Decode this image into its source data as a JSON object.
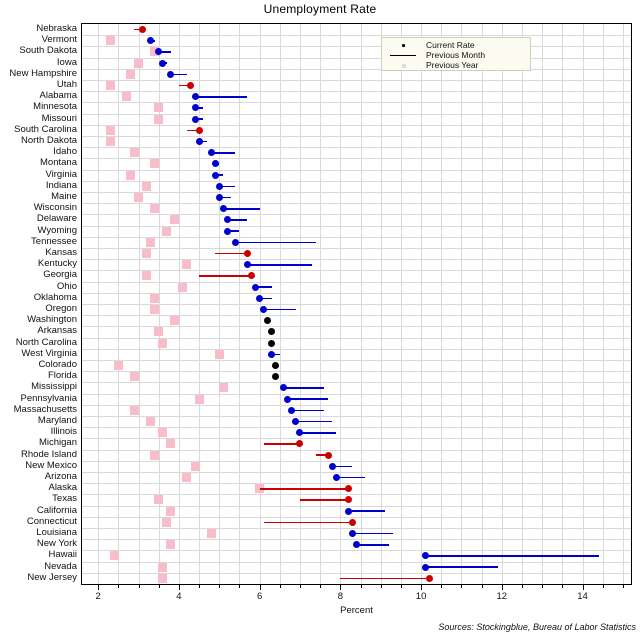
{
  "title": "Unemployment Rate",
  "source_note": "Sources: Stockingblue, Bureau of Labor Statistics",
  "legend": {
    "position": "top-right",
    "items": [
      {
        "label": "Current Rate",
        "key": "dot-marker",
        "color": "#000000"
      },
      {
        "label": "Previous Month",
        "key": "line-marker",
        "color": "#000000"
      },
      {
        "label": "Previous Year",
        "key": "square-marker",
        "color": "#dddddd"
      }
    ]
  },
  "colors": {
    "increase": "#cc0000",
    "decrease": "#0000cc",
    "unchanged": "#000000",
    "previous_year": "#f9bcc9",
    "grid": "#d9d9d9",
    "axis": "#000000",
    "legend_background": "#fbfbf0"
  },
  "chart_data": {
    "type": "scatter",
    "title": "Unemployment Rate",
    "xlabel": "Percent",
    "ylabel": "",
    "xlim": [
      1.6,
      15.2
    ],
    "xticks": [
      2,
      4,
      6,
      8,
      10,
      12,
      14
    ],
    "xticklabels": [
      "2",
      "4",
      "6",
      "8",
      "10",
      "12",
      "14"
    ],
    "minor_tick_step": 0.5,
    "grid": "vertical and horizontal, light gray",
    "legend_position": "top right",
    "series": [
      {
        "name": "Current Rate",
        "marker": "dot"
      },
      {
        "name": "Previous Month",
        "marker": "line"
      },
      {
        "name": "Previous Year",
        "marker": "square"
      }
    ],
    "categories": [
      "Nebraska",
      "Vermont",
      "South Dakota",
      "Iowa",
      "New Hampshire",
      "Utah",
      "Alabama",
      "Minnesota",
      "Missouri",
      "South Carolina",
      "North Dakota",
      "Idaho",
      "Montana",
      "Virginia",
      "Indiana",
      "Maine",
      "Wisconsin",
      "Delaware",
      "Wyoming",
      "Tennessee",
      "Kansas",
      "Kentucky",
      "Georgia",
      "Ohio",
      "Oklahoma",
      "Oregon",
      "Washington",
      "Arkansas",
      "North Carolina",
      "West Virginia",
      "Colorado",
      "Florida",
      "Mississippi",
      "Pennsylvania",
      "Massachusetts",
      "Maryland",
      "Illinois",
      "Michigan",
      "Rhode Island",
      "New Mexico",
      "Arizona",
      "Alaska",
      "Texas",
      "California",
      "Connecticut",
      "Louisiana",
      "New York",
      "Hawaii",
      "Nevada",
      "New Jersey"
    ],
    "rows": [
      {
        "state": "Nebraska",
        "current": 3.1,
        "previous_month": 2.9,
        "previous_year": null
      },
      {
        "state": "Vermont",
        "current": 3.3,
        "previous_month": 3.4,
        "previous_year": 2.3
      },
      {
        "state": "South Dakota",
        "current": 3.5,
        "previous_month": 3.8,
        "previous_year": 3.4
      },
      {
        "state": "Iowa",
        "current": 3.6,
        "previous_month": 3.7,
        "previous_year": 3.0
      },
      {
        "state": "New Hampshire",
        "current": 3.8,
        "previous_month": 4.2,
        "previous_year": 2.8
      },
      {
        "state": "Utah",
        "current": 4.3,
        "previous_month": 4.0,
        "previous_year": 2.3
      },
      {
        "state": "Alabama",
        "current": 4.4,
        "previous_month": 5.7,
        "previous_year": 2.7
      },
      {
        "state": "Minnesota",
        "current": 4.4,
        "previous_month": 4.6,
        "previous_year": 3.5
      },
      {
        "state": "Missouri",
        "current": 4.4,
        "previous_month": 4.6,
        "previous_year": 3.5
      },
      {
        "state": "South Carolina",
        "current": 4.5,
        "previous_month": 4.2,
        "previous_year": 2.3
      },
      {
        "state": "North Dakota",
        "current": 4.5,
        "previous_month": 4.7,
        "previous_year": 2.3
      },
      {
        "state": "Idaho",
        "current": 4.8,
        "previous_month": 5.4,
        "previous_year": 2.9
      },
      {
        "state": "Montana",
        "current": 4.9,
        "previous_month": 5.0,
        "previous_year": 3.4
      },
      {
        "state": "Virginia",
        "current": 4.9,
        "previous_month": 5.1,
        "previous_year": 2.8
      },
      {
        "state": "Indiana",
        "current": 5.0,
        "previous_month": 5.4,
        "previous_year": 3.2
      },
      {
        "state": "Maine",
        "current": 5.0,
        "previous_month": 5.3,
        "previous_year": 3.0
      },
      {
        "state": "Wisconsin",
        "current": 5.1,
        "previous_month": 6.0,
        "previous_year": 3.4
      },
      {
        "state": "Delaware",
        "current": 5.2,
        "previous_month": 5.7,
        "previous_year": 3.9
      },
      {
        "state": "Wyoming",
        "current": 5.2,
        "previous_month": 5.5,
        "previous_year": 3.7
      },
      {
        "state": "Tennessee",
        "current": 5.4,
        "previous_month": 7.4,
        "previous_year": 3.3
      },
      {
        "state": "Kansas",
        "current": 5.7,
        "previous_month": 4.9,
        "previous_year": 3.2
      },
      {
        "state": "Kentucky",
        "current": 5.7,
        "previous_month": 7.3,
        "previous_year": 4.2
      },
      {
        "state": "Georgia",
        "current": 5.8,
        "previous_month": 4.5,
        "previous_year": 3.2
      },
      {
        "state": "Ohio",
        "current": 5.9,
        "previous_month": 6.3,
        "previous_year": 4.1
      },
      {
        "state": "Oklahoma",
        "current": 6.0,
        "previous_month": 6.3,
        "previous_year": 3.4
      },
      {
        "state": "Oregon",
        "current": 6.1,
        "previous_month": 6.9,
        "previous_year": 3.4
      },
      {
        "state": "Washington",
        "current": 6.2,
        "previous_month": 6.2,
        "previous_year": 3.9
      },
      {
        "state": "Arkansas",
        "current": 6.3,
        "previous_month": 6.3,
        "previous_year": 3.5
      },
      {
        "state": "North Carolina",
        "current": 6.3,
        "previous_month": 6.3,
        "previous_year": 3.6
      },
      {
        "state": "West Virginia",
        "current": 6.3,
        "previous_month": 6.5,
        "previous_year": 5.0
      },
      {
        "state": "Colorado",
        "current": 6.4,
        "previous_month": 6.4,
        "previous_year": 2.5
      },
      {
        "state": "Florida",
        "current": 6.4,
        "previous_month": 6.4,
        "previous_year": 2.9
      },
      {
        "state": "Mississippi",
        "current": 6.6,
        "previous_month": 7.6,
        "previous_year": 5.1
      },
      {
        "state": "Pennsylvania",
        "current": 6.7,
        "previous_month": 7.7,
        "previous_year": 4.5
      },
      {
        "state": "Massachusetts",
        "current": 6.8,
        "previous_month": 7.6,
        "previous_year": 2.9
      },
      {
        "state": "Maryland",
        "current": 6.9,
        "previous_month": 7.8,
        "previous_year": 3.3
      },
      {
        "state": "Illinois",
        "current": 7.0,
        "previous_month": 7.9,
        "previous_year": 3.6
      },
      {
        "state": "Michigan",
        "current": 7.0,
        "previous_month": 6.1,
        "previous_year": 3.8
      },
      {
        "state": "Rhode Island",
        "current": 7.7,
        "previous_month": 7.4,
        "previous_year": 3.4
      },
      {
        "state": "New Mexico",
        "current": 7.8,
        "previous_month": 8.3,
        "previous_year": 4.4
      },
      {
        "state": "Arizona",
        "current": 7.9,
        "previous_month": 8.6,
        "previous_year": 4.2
      },
      {
        "state": "Alaska",
        "current": 8.2,
        "previous_month": 6.0,
        "previous_year": 6.0
      },
      {
        "state": "Texas",
        "current": 8.2,
        "previous_month": 7.0,
        "previous_year": 3.5
      },
      {
        "state": "California",
        "current": 8.2,
        "previous_month": 9.1,
        "previous_year": 3.8
      },
      {
        "state": "Connecticut",
        "current": 8.3,
        "previous_month": 6.1,
        "previous_year": 3.7
      },
      {
        "state": "Louisiana",
        "current": 8.3,
        "previous_month": 9.3,
        "previous_year": 4.8
      },
      {
        "state": "New York",
        "current": 8.4,
        "previous_month": 9.2,
        "previous_year": 3.8
      },
      {
        "state": "Hawaii",
        "current": 10.1,
        "previous_month": 14.4,
        "previous_year": 2.4
      },
      {
        "state": "Nevada",
        "current": 10.1,
        "previous_month": 11.9,
        "previous_year": 3.6
      },
      {
        "state": "New Jersey",
        "current": 10.2,
        "previous_month": 8.0,
        "previous_year": 3.6
      }
    ]
  }
}
